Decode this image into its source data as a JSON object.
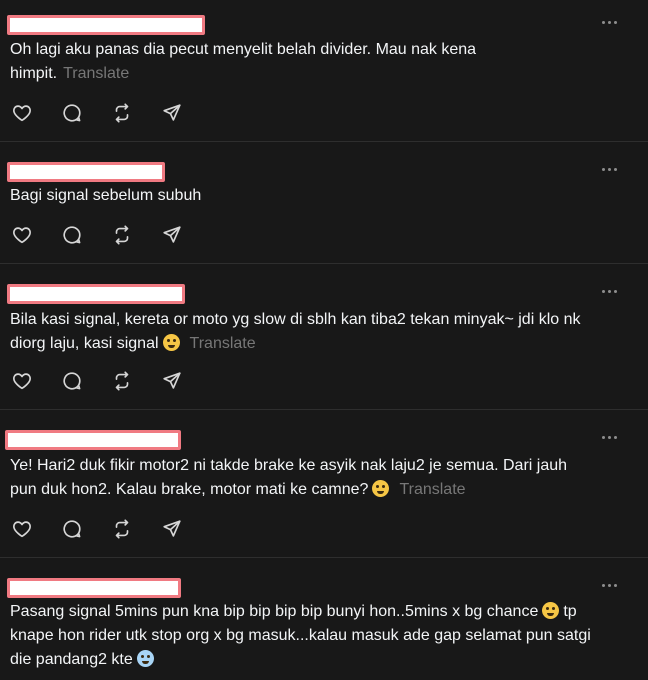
{
  "posts": [
    {
      "text_line1": "Oh lagi aku panas dia pecut menyelit belah divider. Mau nak kena",
      "text_line2": "himpit.",
      "translate": "Translate",
      "emoji": ""
    },
    {
      "text_line1": "Bagi signal sebelum subuh",
      "text_line2": "",
      "translate": "",
      "emoji": ""
    },
    {
      "text_line1": "Bila kasi signal, kereta or moto yg slow di sblh kan tiba2 tekan minyak~ jdi klo nk",
      "text_line2": "diorg laju, kasi signal",
      "translate": "Translate",
      "emoji": "laughing-tears-emoji"
    },
    {
      "text_line1": "Ye! Hari2 duk fikir motor2 ni takde brake ke asyik nak laju2 je semua. Dari jauh",
      "text_line2": "pun duk hon2. Kalau brake, motor mati ke camne?",
      "translate": "Translate",
      "emoji": "pensive-emoji"
    },
    {
      "text_line1": "Pasang signal 5mins pun kna bip bip bip bip bunyi hon..5mins x bg chance",
      "text_line1_tail": "tp",
      "text_line2": "knape hon rider utk stop org x bg masuk...kalau masuk ade gap selamat pun satgi",
      "text_line3": "die pandang2 kte",
      "translate": "",
      "emoji": "laughing-tears-emoji",
      "emoji2": "cold-face-emoji"
    }
  ],
  "icons": {
    "like": "heart-icon",
    "reply": "comment-icon",
    "repost": "repost-icon",
    "share": "send-icon",
    "more": "more-dots-icon"
  },
  "colors": {
    "background": "#181818",
    "text": "#f3f5f7",
    "muted": "#777777",
    "divider": "#2e2e2e",
    "redaction": "#f07a82"
  }
}
